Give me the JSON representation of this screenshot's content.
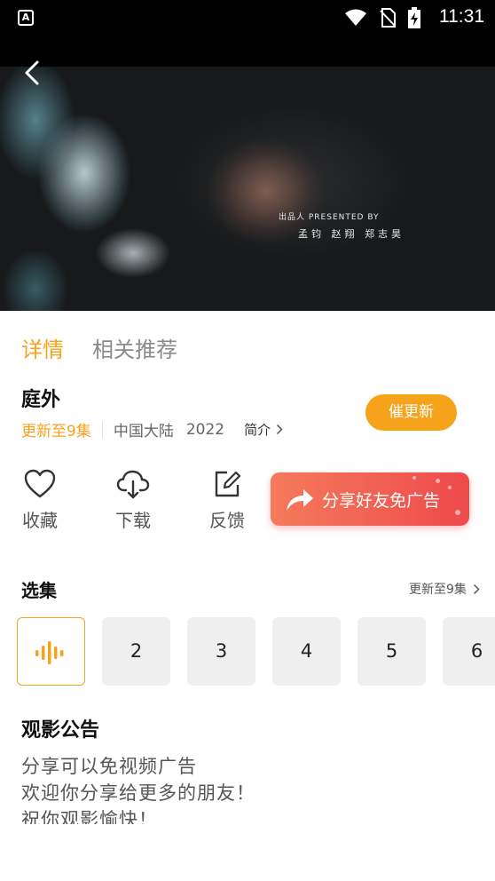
{
  "status_bar": {
    "app_badge": "A",
    "time": "11:31",
    "icons": [
      "wifi-icon",
      "no-sim-icon",
      "battery-charging-icon"
    ]
  },
  "video": {
    "credit_label": "出品人 PRESENTED BY",
    "credit_names": "孟钧  赵翔  郑志昊"
  },
  "tabs": [
    {
      "label": "详情",
      "active": true
    },
    {
      "label": "相关推荐",
      "active": false
    }
  ],
  "show": {
    "title": "庭外",
    "update_status": "更新至9集",
    "region": "中国大陆",
    "year": "2022",
    "intro_label": "简介"
  },
  "urge_button": "催更新",
  "actions": [
    {
      "label": "收藏",
      "icon": "heart-icon"
    },
    {
      "label": "下载",
      "icon": "cloud-download-icon"
    },
    {
      "label": "反馈",
      "icon": "edit-icon"
    }
  ],
  "share_button": "分享好友免广告",
  "episodes": {
    "header": "选集",
    "more": "更新至9集",
    "items": [
      "playing",
      "2",
      "3",
      "4",
      "5",
      "6"
    ]
  },
  "notice": {
    "title": "观影公告",
    "lines": [
      "分享可以免视频广告",
      "欢迎你分享给更多的朋友！",
      "祝你观影愉快！"
    ]
  },
  "colors": {
    "accent": "#f7a21b",
    "share_gradient_start": "#f57a5b",
    "share_gradient_end": "#ee4a4c"
  }
}
